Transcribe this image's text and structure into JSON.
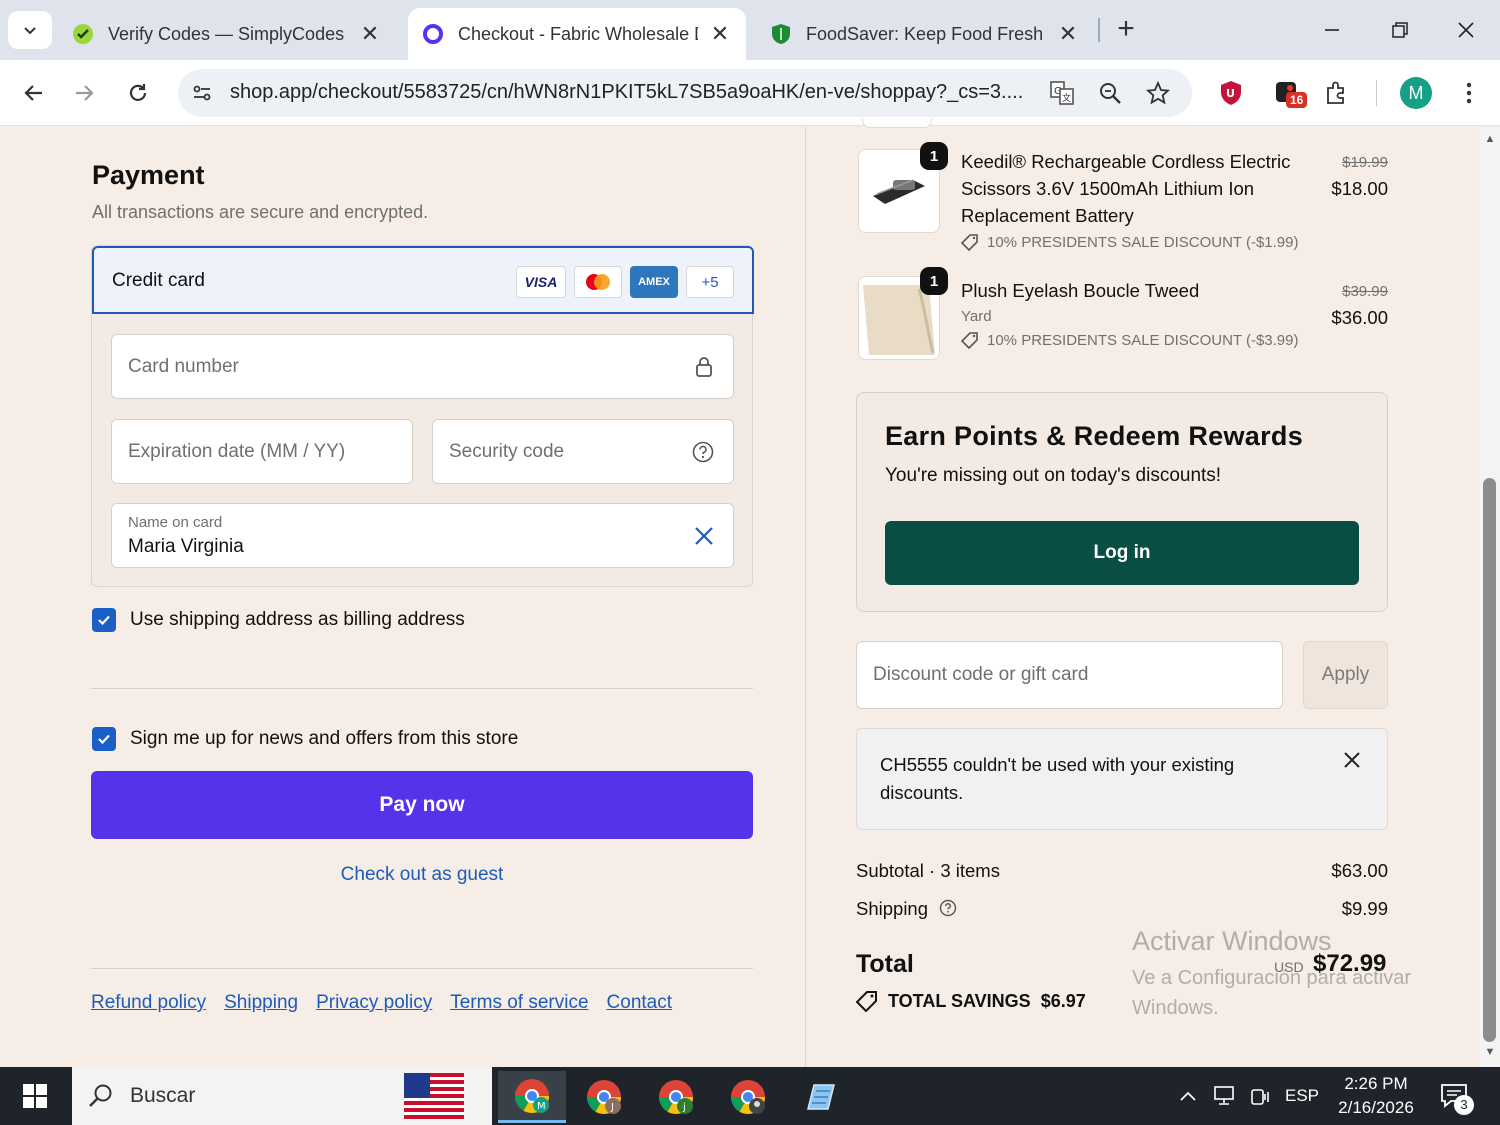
{
  "browser": {
    "tabs": [
      {
        "title": "Verify Codes — SimplyCodes",
        "active": false
      },
      {
        "title": "Checkout - Fabric Wholesale Di",
        "active": true
      },
      {
        "title": "FoodSaver: Keep Food Fresh wi",
        "active": false
      }
    ],
    "url": "shop.app/checkout/5583725/cn/hWN8rN1PKIT5kL7SB5a9oaHK/en-ve/shoppay?_cs=3....",
    "extension_badge": "16",
    "profile_initial": "M"
  },
  "payment": {
    "title": "Payment",
    "subtitle": "All transactions are secure and encrypted.",
    "method_label": "Credit card",
    "card_brands": [
      "VISA",
      "mastercard",
      "AMEX",
      "+5"
    ],
    "card_number_placeholder": "Card number",
    "expiration_placeholder": "Expiration date (MM / YY)",
    "security_placeholder": "Security code",
    "name_label": "Name on card",
    "name_value": "Maria Virginia",
    "billing_checkbox": "Use shipping address as billing address",
    "news_checkbox": "Sign me up for news and offers from this store",
    "pay_button": "Pay now",
    "guest_link": "Check out as guest",
    "footer_links": [
      "Refund policy",
      "Shipping",
      "Privacy policy",
      "Terms of service",
      "Contact"
    ]
  },
  "order": {
    "items": [
      {
        "qty": "1",
        "name": "Keedil® Rechargeable Cordless Electric Scissors 3.6V 1500mAh Lithium Ion Replacement Battery",
        "variant": "",
        "discount": "10% PRESIDENTS SALE DISCOUNT (-$1.99)",
        "price_old": "$19.99",
        "price": "$18.00"
      },
      {
        "qty": "1",
        "name": "Plush Eyelash Boucle Tweed",
        "variant": "Yard",
        "discount": "10% PRESIDENTS SALE DISCOUNT (-$3.99)",
        "price_old": "$39.99",
        "price": "$36.00"
      }
    ],
    "rewards": {
      "title": "Earn Points & Redeem Rewards",
      "subtitle": "You're missing out on today's discounts!",
      "login_button": "Log in"
    },
    "discount_placeholder": "Discount code or gift card",
    "apply_button": "Apply",
    "notice": "CH5555 couldn't be used with your existing discounts.",
    "subtotal_label": "Subtotal · 3 items",
    "subtotal_value": "$63.00",
    "shipping_label": "Shipping",
    "shipping_value": "$9.99",
    "total_label": "Total",
    "total_currency": "USD",
    "total_value": "$72.99",
    "savings_label": "TOTAL SAVINGS",
    "savings_value": "$6.97"
  },
  "watermark": {
    "line1": "Activar Windows",
    "line2": "Ve a Configuración para activar Windows."
  },
  "taskbar": {
    "search_text": "Buscar",
    "language": "ESP",
    "time": "2:26 PM",
    "date": "2/16/2026",
    "notification_count": "3"
  }
}
